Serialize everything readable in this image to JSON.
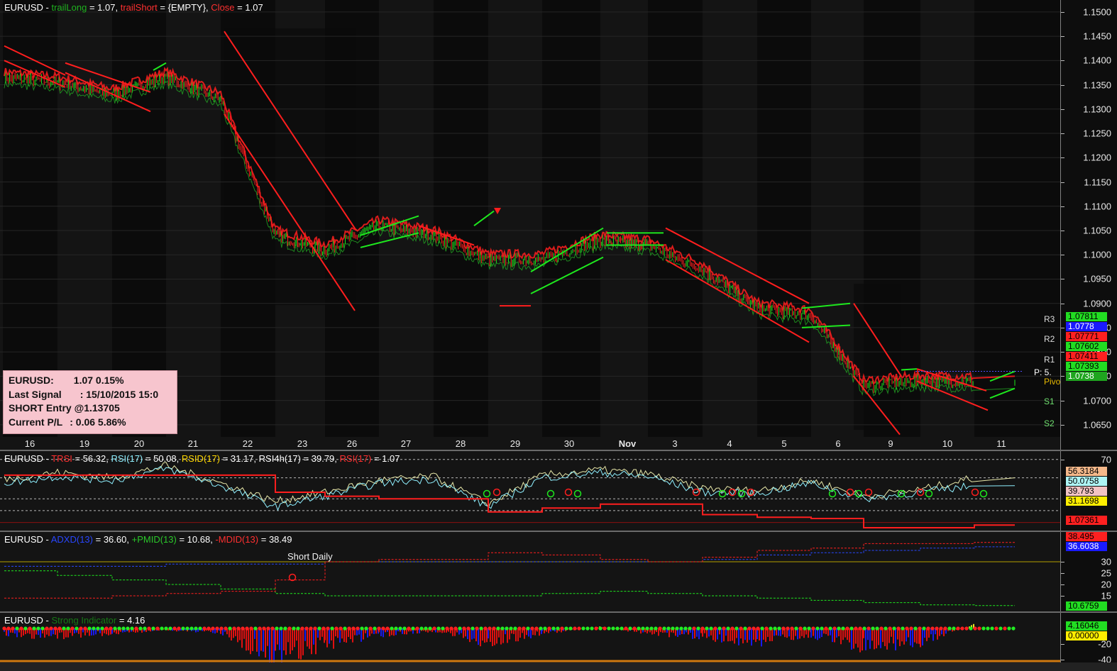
{
  "colors": {
    "background": "#141414",
    "band_dark": "#090909",
    "up": "#1ee81e",
    "down": "#ff1e1e",
    "trsi": "#eaeaaa",
    "rsi": "#8ff0ff",
    "rsid": "#ffd700",
    "adx": "#2846ff",
    "pmid": "#1ee81e",
    "mdid": "#ff1e1e"
  },
  "price_pane": {
    "title": {
      "symbol": "EURUSD",
      "trail_long_label": "trailLong",
      "trail_long_value": "= 1.07,",
      "trail_short_label": "trailShort",
      "trail_short_value": "= {EMPTY},",
      "close_label": "Close",
      "close_value": "= 1.07"
    },
    "y_ticks": [
      "1.1500",
      "1.1450",
      "1.1400",
      "1.1350",
      "1.1300",
      "1.1250",
      "1.1200",
      "1.1150",
      "1.1100",
      "1.1050",
      "1.1000",
      "1.0950",
      "1.0900",
      "1.0850",
      "1.0800",
      "1.0750",
      "1.0700",
      "1.0650"
    ],
    "badges": [
      {
        "text": "1.07811",
        "bg": "#22dd22",
        "fg": "#000000"
      },
      {
        "text": "1.0778",
        "bg": "#1a1aff",
        "fg": "#ffffff"
      },
      {
        "text": "1.07771",
        "bg": "#ff2020",
        "fg": "#000000"
      },
      {
        "text": "1.07602",
        "bg": "#22dd22",
        "fg": "#000000"
      },
      {
        "text": "1.07411",
        "bg": "#ff2020",
        "fg": "#000000"
      },
      {
        "text": "1.07393",
        "bg": "#22dd22",
        "fg": "#000000"
      },
      {
        "text": "1.0738",
        "bg": "#1fa51f",
        "fg": "#ffffff"
      }
    ],
    "pivot_labels": {
      "r3": "R3",
      "r2": "R2",
      "r1": "R1",
      "p": "P:  5.",
      "pivot": "Pivo",
      "s1": "S1",
      "s2": "S2"
    },
    "x_labels": [
      "16",
      "19",
      "20",
      "21",
      "22",
      "23",
      "26",
      "27",
      "28",
      "29",
      "30",
      "Nov",
      "3",
      "4",
      "5",
      "6",
      "9",
      "10",
      "11"
    ]
  },
  "info_box": {
    "row1_label": "EURUSD:",
    "row1_value": "1.07 0.15%",
    "row2_label": "Last Signal",
    "row2_value": ": 15/10/2015 15:0",
    "row3": "SHORT Entry @1.13705",
    "row4_label": "Current P/L",
    "row4_value": ": 0.06 5.86%"
  },
  "rsi_pane": {
    "title": {
      "symbol": "EURUSD",
      "trsi_label": "TRSI",
      "trsi_value": "= 56.32,",
      "rsi_label": "RSI(17)",
      "rsi_value": "= 50.08,",
      "rsid_label": "RSID(17)",
      "rsid_value": "= 31.17,",
      "rsi4h_label": "RSI4h(17)",
      "rsi4h_value": "= 39.79,",
      "rsi2_label": "RSI(17)",
      "rsi2_value": "= 1.07"
    },
    "y_ticks": [
      "70"
    ],
    "badges": [
      {
        "text": "56.3184",
        "bg": "#f5b88a",
        "fg": "#000000"
      },
      {
        "text": "50.0758",
        "bg": "#aef5f5",
        "fg": "#000000"
      },
      {
        "text": "39.793",
        "bg": "#f3c3c3",
        "fg": "#000000"
      },
      {
        "text": "31.1698",
        "bg": "#ffee00",
        "fg": "#000000"
      },
      {
        "text": "1.07361",
        "bg": "#ff2020",
        "fg": "#000000"
      }
    ]
  },
  "adx_pane": {
    "title": {
      "symbol": "EURUSD",
      "adx_label": "ADXD(13)",
      "adx_value": "= 36.60,",
      "pmid_label": "+PMID(13)",
      "pmid_value": "= 10.68,",
      "mdid_label": "-MDID(13)",
      "mdid_value": "= 38.49"
    },
    "annotation": "Short Daily",
    "y_ticks": [
      "30",
      "25",
      "20",
      "15"
    ],
    "badges": [
      {
        "text": "38.495",
        "bg": "#ff2020",
        "fg": "#000000"
      },
      {
        "text": "36.6038",
        "bg": "#1a1aff",
        "fg": "#ffffff"
      },
      {
        "text": "10.6759",
        "bg": "#22dd22",
        "fg": "#000000"
      }
    ]
  },
  "strong_pane": {
    "title": {
      "symbol": "EURUSD",
      "label": "Strong Indicator",
      "value": "= 4.16"
    },
    "y_ticks": [
      "-20",
      "-40"
    ],
    "badges": [
      {
        "text": "4.16046",
        "bg": "#22dd22",
        "fg": "#000000"
      },
      {
        "text": "0.00000",
        "bg": "#ffee00",
        "fg": "#000000"
      }
    ]
  },
  "chart_data": [
    {
      "type": "line",
      "name": "EURUSD price (approx. close)",
      "x": [
        "16",
        "19",
        "20",
        "21",
        "22",
        "23",
        "26",
        "27",
        "28",
        "29",
        "30",
        "Nov",
        "3",
        "4",
        "5",
        "6",
        "9",
        "10",
        "11"
      ],
      "values": [
        1.1365,
        1.1355,
        1.133,
        1.1365,
        1.132,
        1.104,
        1.101,
        1.106,
        1.104,
        1.099,
        1.099,
        1.103,
        1.102,
        1.097,
        1.089,
        1.0875,
        1.073,
        1.074,
        1.0738
      ],
      "ylim": [
        1.0625,
        1.151
      ]
    },
    {
      "type": "line",
      "name": "RSI pane",
      "series": [
        {
          "name": "TRSI",
          "values": [
            55,
            60,
            56,
            65,
            52,
            38,
            45,
            54,
            57,
            36,
            58,
            62,
            59,
            48,
            46,
            54,
            42,
            47,
            56
          ]
        },
        {
          "name": "RSI(17)",
          "values": [
            52,
            57,
            54,
            63,
            50,
            34,
            42,
            52,
            55,
            34,
            56,
            60,
            57,
            45,
            44,
            52,
            40,
            45,
            50
          ]
        }
      ]
    },
    {
      "type": "line",
      "name": "ADX pane",
      "series": [
        {
          "name": "ADXD(13)",
          "values": [
            28,
            28,
            28,
            29,
            29,
            29,
            30,
            30,
            30,
            30,
            30,
            30,
            30,
            31,
            33,
            34,
            35,
            36,
            36.6
          ]
        },
        {
          "name": "+PMID(13)",
          "values": [
            26,
            24,
            22,
            20,
            18,
            16,
            15,
            15,
            15,
            15,
            16,
            17,
            16,
            15,
            14,
            13,
            12,
            11,
            10.68
          ]
        },
        {
          "name": "-MDID(13)",
          "values": [
            14,
            14,
            15,
            16,
            17,
            22,
            30,
            31,
            31,
            34,
            33,
            31,
            30,
            32,
            35,
            36,
            38,
            38,
            38.49
          ]
        }
      ],
      "y_ticks": [
        15,
        20,
        25,
        30
      ]
    },
    {
      "type": "bar",
      "name": "Strong Indicator",
      "categories": [
        "16",
        "19",
        "20",
        "21",
        "22",
        "23",
        "26",
        "27",
        "28",
        "29",
        "30",
        "Nov",
        "3",
        "4",
        "5",
        "6",
        "9",
        "10",
        "11"
      ],
      "values": [
        -8,
        -10,
        -6,
        -2,
        -5,
        -38,
        -20,
        -8,
        -3,
        -18,
        -6,
        2,
        -6,
        -10,
        -18,
        -8,
        -25,
        -16,
        4.16
      ],
      "y_ticks": [
        -20,
        -40
      ]
    }
  ]
}
